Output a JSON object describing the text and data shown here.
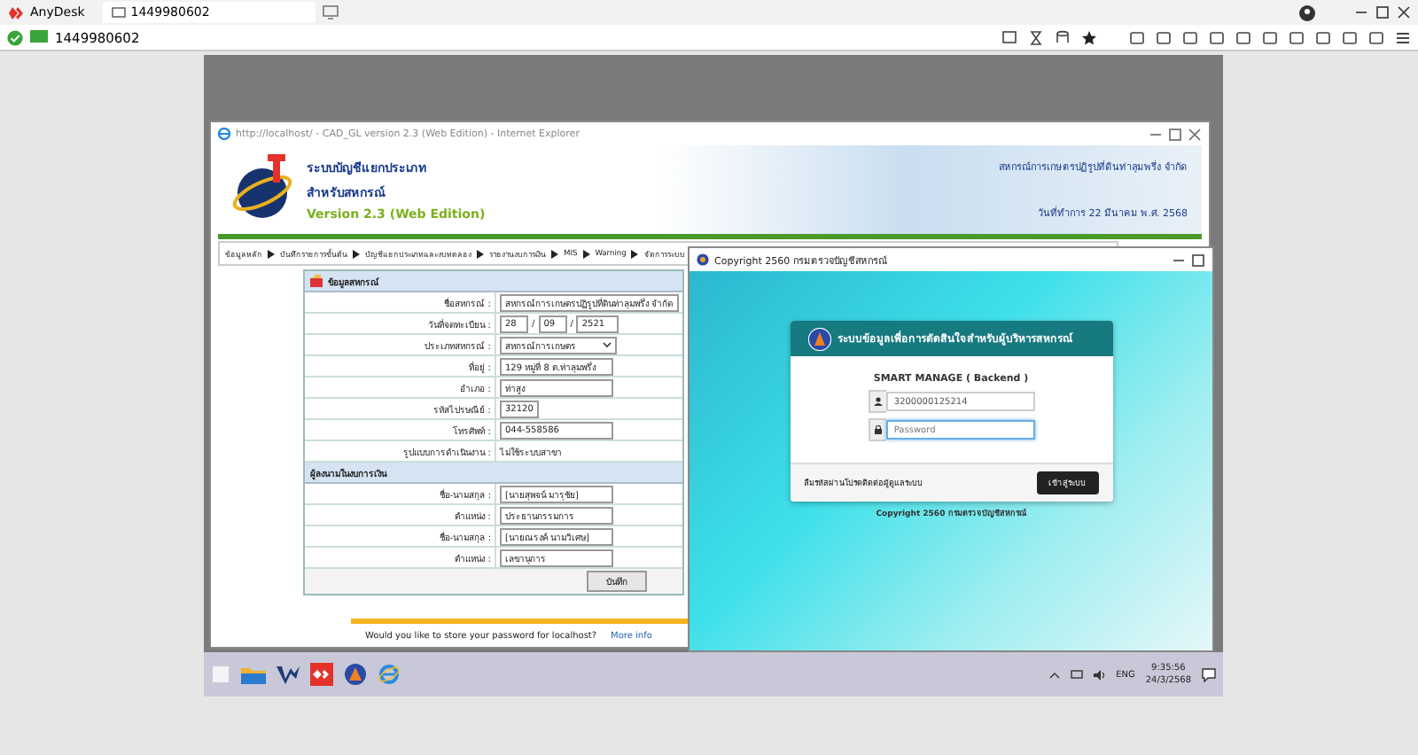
{
  "anydesk": {
    "app_name": "AnyDesk",
    "tab": "1449980602",
    "address": "1449980602"
  },
  "ie_window": {
    "title": "http://localhost/ - CAD_GL version 2.3 (Web Edition) - Internet Explorer",
    "header": {
      "title_line1": "ระบบบัญชีแยกประเภท",
      "title_line2": "สำหรับสหกรณ์",
      "version": "Version 2.3 (Web Edition)",
      "coop_name": "สหกรณ์การเกษตรปฏิรูปที่ดินท่าลุมพรึ่ง จำกัด",
      "work_date": "วันที่ทำการ 22 มีนาคม พ.ศ. 2568"
    },
    "menu": [
      "ข้อมูลหลัก",
      "บันทึกรายการขั้นต้น",
      "บัญชีแยกประเภทและงบทดลอง",
      "รายงานงบการเงิน",
      "MIS",
      "Warning",
      "จัดการระบบ"
    ],
    "form": {
      "section": "ข้อมูลสหกรณ์",
      "rows": [
        {
          "kind": "text",
          "label": "ชื่อสหกรณ์ :",
          "value": "สหกรณ์การเกษตรปฏิรูปที่ดินท่าลุมพรึ่ง  จำกัด"
        },
        {
          "kind": "date",
          "label": "วันที่จดทะเบียน :",
          "parts": [
            "28",
            "09",
            "2521"
          ],
          "separator": "/"
        },
        {
          "kind": "select",
          "label": "ประเภทสหกรณ์ :",
          "value": "สหกรณ์การเกษตร"
        },
        {
          "kind": "text",
          "label": "ที่อยู่ :",
          "value": "129 หมู่ที่ 8 ต.ท่าลุมพรึ่ง"
        },
        {
          "kind": "text",
          "label": "อำเภอ :",
          "value": "ท่าสูง"
        },
        {
          "kind": "short",
          "label": "รหัสไปรษณีย์ :",
          "value": "32120"
        },
        {
          "kind": "text",
          "label": "โทรศัพท์ :",
          "value": "044-558586"
        },
        {
          "kind": "static",
          "label": "รูปแบบการดำเนินงาน :",
          "value": "ไม่ใช้ระบบสาขา"
        }
      ],
      "signers_section": "ผู้ลงนามในงบการเงิน",
      "signers": [
        {
          "label": "ชื่อ-นามสกุล :",
          "value": "[นายสุพจน์ มารุชัย]"
        },
        {
          "label": "ตำแหน่ง :",
          "value": "ประธานกรรมการ"
        },
        {
          "label": "ชื่อ-นามสกุล :",
          "value": "[นายณรงค์ นามวิเศษ]"
        },
        {
          "label": "ตำแหน่ง :",
          "value": "เลขานุการ"
        }
      ],
      "save_button": "บันทึก"
    },
    "notification": {
      "message": "Would you like to store your password for localhost?",
      "link": "More info"
    }
  },
  "login_window": {
    "title": "Copyright 2560 กรมตรวจบัญชีสหกรณ์",
    "card_title": "ระบบข้อมูลเพื่อการตัดสินใจสำหรับผู้บริหารสหกรณ์",
    "subtitle": "SMART MANAGE ( Backend )",
    "username": "3200000125214",
    "password_placeholder": "Password",
    "forgot_text": "ลืมรหัสผ่านโปรดติดต่อผู้ดูแลระบบ",
    "login_button": "เข้าสู่ระบบ",
    "footer": "Copyright 2560 กรมตรวจบัญชีสหกรณ์"
  },
  "taskbar": {
    "language": "ENG",
    "time": "9:35:56",
    "date": "24/3/2568"
  }
}
